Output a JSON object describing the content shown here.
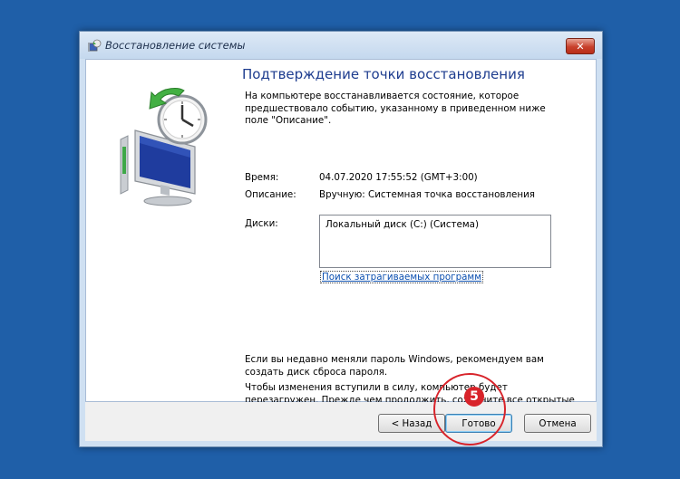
{
  "window": {
    "title": "Восстановление системы"
  },
  "page": {
    "heading": "Подтверждение точки восстановления",
    "intro": "На компьютере восстанавливается состояние, которое предшествовало событию, указанному в приведенном ниже поле \"Описание\"."
  },
  "fields": {
    "time_label": "Время:",
    "time_value": "04.07.2020 17:55:52 (GMT+3:00)",
    "description_label": "Описание:",
    "description_value": "Вручную: Системная точка восстановления",
    "disks_label": "Диски:",
    "disks": [
      "Локальный диск (C:) (Система)"
    ]
  },
  "links": {
    "scan_programs": "Поиск затрагиваемых программ"
  },
  "notes": {
    "password": "Если вы недавно меняли пароль Windows, рекомендуем вам создать диск сброса пароля.",
    "restart": "Чтобы изменения вступили в силу, компьютер будет перезагружен. Прежде чем продолжить, сохраните все открытые файлы и закройте все программы."
  },
  "buttons": {
    "back": "< Назад",
    "finish": "Готово",
    "cancel": "Отмена"
  },
  "annotation": {
    "step_number": "5",
    "color": "#d8232a"
  },
  "icons": {
    "title": "system-restore-icon",
    "close": "close-icon",
    "illustration": "computer-with-clock-icon"
  }
}
